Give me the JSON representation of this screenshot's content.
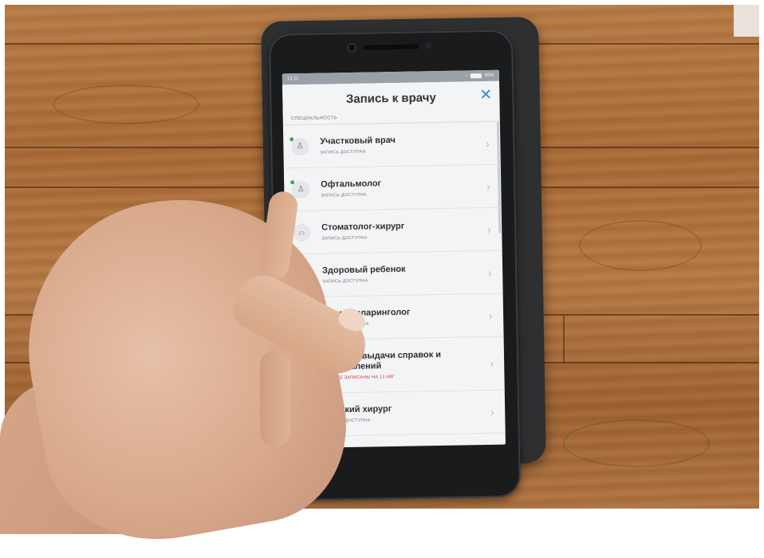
{
  "screen": {
    "status": {
      "time": "12:11",
      "battery": "85%"
    },
    "header": {
      "title": "Запись к врачу",
      "close_icon": "close-icon"
    },
    "section_label": "СПЕЦИАЛЬНОСТЬ",
    "items": [
      {
        "name": "Участковый врач",
        "status": "ЗАПИСЬ ДОСТУПНА",
        "icon": "person-icon",
        "status_color": "#7a7d82",
        "dot": "green"
      },
      {
        "name": "Офтальмолог",
        "status": "ЗАПИСЬ ДОСТУПНА",
        "icon": "person-icon",
        "status_color": "#7a7d82",
        "dot": "green"
      },
      {
        "name": "Стоматолог-хирург",
        "status": "ЗАПИСЬ ДОСТУПНА",
        "icon": "tooth-icon",
        "status_color": "#7a7d82",
        "dot": "green"
      },
      {
        "name": "Здоровый ребенок",
        "status": "ЗАПИСЬ ДОСТУПНА",
        "icon": "child-icon",
        "status_color": "#7a7d82",
        "dot": "green"
      },
      {
        "name": "Оториноларинголог",
        "status": "ЗАПИСЬ ДОСТУПНА",
        "icon": "ear-icon",
        "status_color": "#7a7d82",
        "dot": "green"
      },
      {
        "name": "Кабинет выдачи справок и направлений",
        "status": "ВЫ УЖЕ ЗАПИСАНЫ НА 13 АВГ",
        "icon": "folder-icon",
        "status_color": "#d4383d",
        "dot": "red"
      },
      {
        "name": "Детский хирург",
        "status": "ЗАПИСЬ ДОСТУПНА",
        "icon": "eye-icon",
        "status_color": "#7a7d82",
        "dot": "green"
      }
    ]
  },
  "colors": {
    "accent": "#2b8fe3",
    "available_dot": "#3aa75a",
    "booked_red": "#d4383d"
  }
}
